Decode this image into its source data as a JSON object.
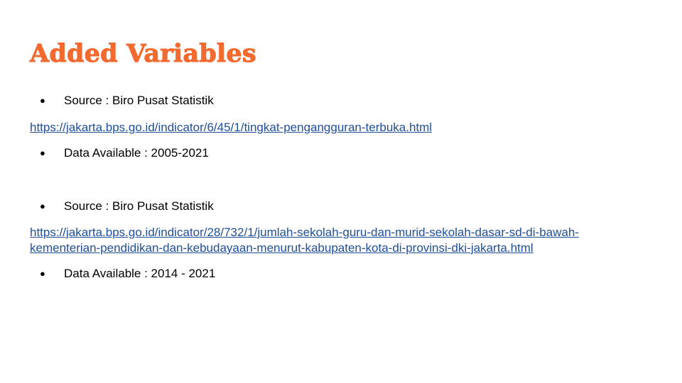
{
  "slide": {
    "title": "Added Variables",
    "bullet_glyph": "●",
    "group1": {
      "source": "Source : Biro Pusat Statistik",
      "link": "https://jakarta.bps.go.id/indicator/6/45/1/tingkat-pengangguran-terbuka.html",
      "data_available": "Data Available : 2005-2021"
    },
    "group2": {
      "source": "Source  : Biro Pusat Statistik",
      "link_line1": "https://jakarta.bps.go.id/indicator/28/732/1/jumlah-sekolah-guru-dan-murid-sekolah-dasar-sd-di-bawah-",
      "link_line2": "kementerian-pendidikan-dan-kebudayaan-menurut-kabupaten-kota-di-provinsi-dki-jakarta.html",
      "data_available": "Data Available : 2014 - 2021"
    },
    "colors": {
      "title": "#f26a2f",
      "link": "#1f4e9c",
      "text": "#000000"
    }
  }
}
